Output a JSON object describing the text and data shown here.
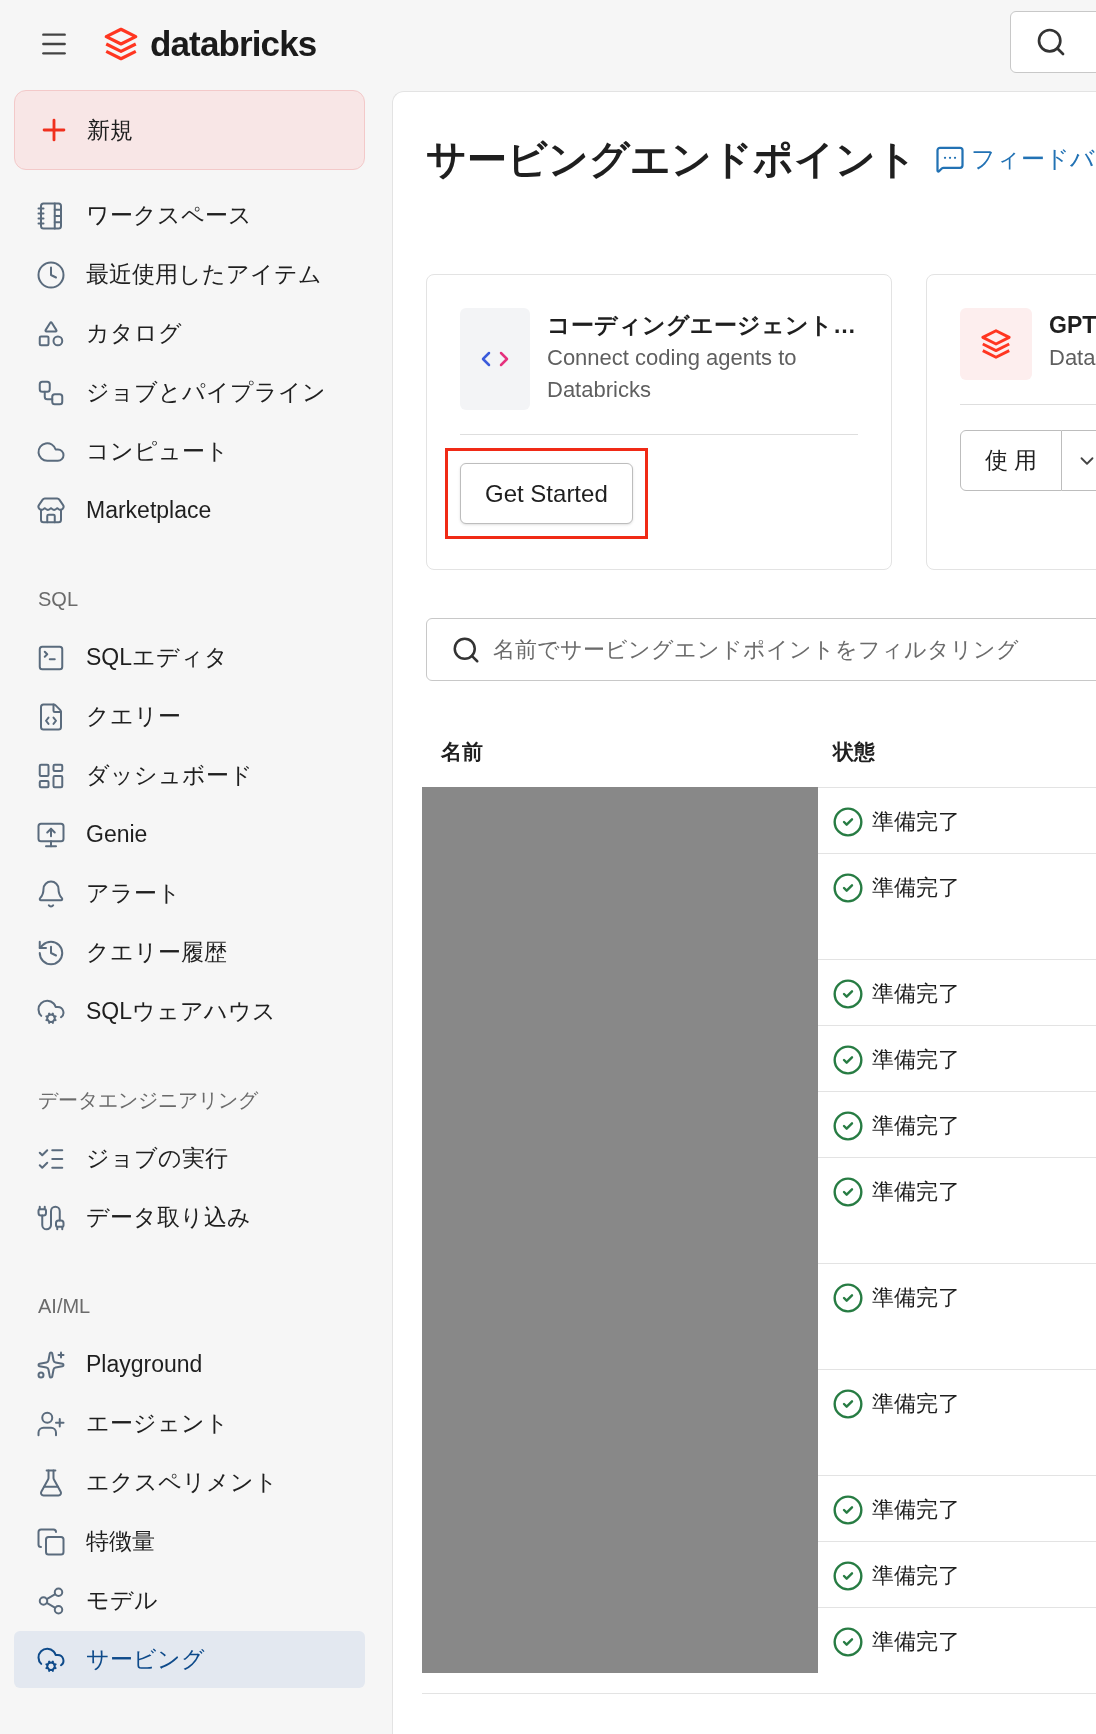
{
  "header": {
    "logo_text": "databricks"
  },
  "sidebar": {
    "new_button": "新規",
    "sections": [
      {
        "items": [
          {
            "label": "ワークスペース",
            "selected": false
          },
          {
            "label": "最近使用したアイテム",
            "selected": false
          },
          {
            "label": "カタログ",
            "selected": false
          },
          {
            "label": "ジョブとパイプライン",
            "selected": false
          },
          {
            "label": "コンピュート",
            "selected": false
          },
          {
            "label": "Marketplace",
            "selected": false
          }
        ]
      },
      {
        "title": "SQL",
        "items": [
          {
            "label": "SQLエディタ",
            "selected": false
          },
          {
            "label": "クエリー",
            "selected": false
          },
          {
            "label": "ダッシュボード",
            "selected": false
          },
          {
            "label": "Genie",
            "selected": false
          },
          {
            "label": "アラート",
            "selected": false
          },
          {
            "label": "クエリー履歴",
            "selected": false
          },
          {
            "label": "SQLウェアハウス",
            "selected": false
          }
        ]
      },
      {
        "title": "データエンジニアリング",
        "items": [
          {
            "label": "ジョブの実行",
            "selected": false
          },
          {
            "label": "データ取り込み",
            "selected": false
          }
        ]
      },
      {
        "title": "AI/ML",
        "items": [
          {
            "label": "Playground",
            "selected": false
          },
          {
            "label": "エージェント",
            "selected": false
          },
          {
            "label": "エクスペリメント",
            "selected": false
          },
          {
            "label": "特徴量",
            "selected": false
          },
          {
            "label": "モデル",
            "selected": false
          },
          {
            "label": "サービング",
            "selected": true
          }
        ]
      }
    ]
  },
  "main": {
    "title": "サービングエンドポイント",
    "feedback_link": "フィードバ",
    "cards": [
      {
        "title": "コーディングエージェント…",
        "description": "Connect coding agents to Databricks",
        "button": "Get Started",
        "highlighted": true,
        "kind": "code"
      },
      {
        "title": "GPT",
        "description": "Data",
        "button": "使 用",
        "highlighted": false,
        "kind": "logo"
      }
    ],
    "filter": {
      "placeholder": "名前でサービングエンドポイントをフィルタリング"
    },
    "table": {
      "columns": [
        "名前",
        "状態"
      ],
      "rows": [
        {
          "status": "準備完了"
        },
        {
          "status": "準備完了"
        },
        {
          "status": "準備完了"
        },
        {
          "status": "準備完了"
        },
        {
          "status": "準備完了"
        },
        {
          "status": "準備完了"
        },
        {
          "status": "準備完了"
        },
        {
          "status": "準備完了"
        },
        {
          "status": "準備完了"
        },
        {
          "status": "準備完了"
        },
        {
          "status": "準備完了"
        }
      ]
    }
  }
}
